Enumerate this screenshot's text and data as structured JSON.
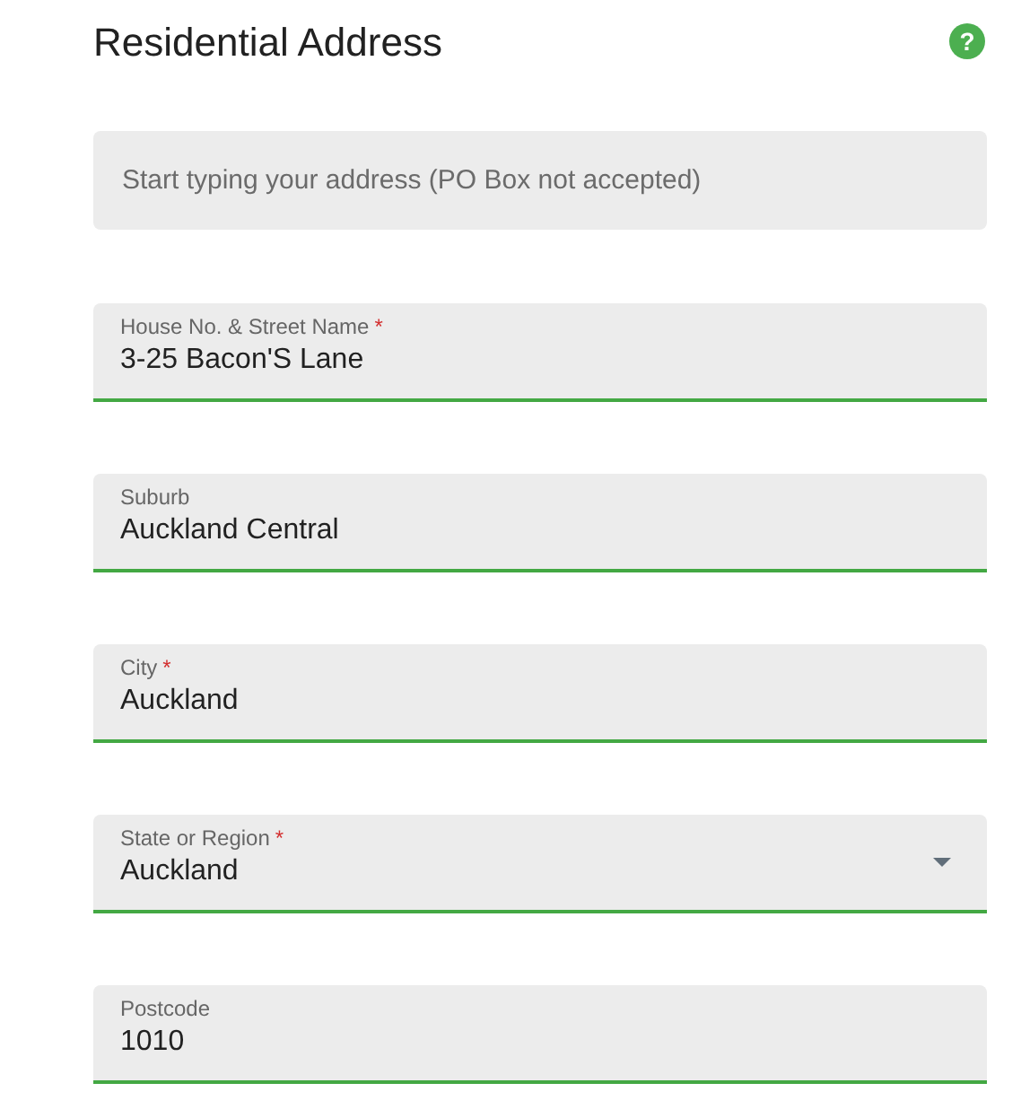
{
  "title": "Residential Address",
  "help_icon": "?",
  "address_search": {
    "placeholder": "Start typing your address (PO Box not accepted)"
  },
  "fields": [
    {
      "kind": "text",
      "label": "House No. & Street Name",
      "required_mark": "*",
      "value": "3-25 Bacon'S Lane",
      "valid": true
    },
    {
      "kind": "text",
      "label": "Suburb",
      "value": "Auckland Central",
      "valid": true
    },
    {
      "kind": "text",
      "label": "City",
      "required_mark": "*",
      "value": "Auckland",
      "valid": true
    },
    {
      "kind": "select",
      "label": "State or Region",
      "required_mark": "*",
      "value": "Auckland",
      "valid": true
    },
    {
      "kind": "text",
      "label": "Postcode",
      "value": "1010",
      "valid": true
    }
  ]
}
